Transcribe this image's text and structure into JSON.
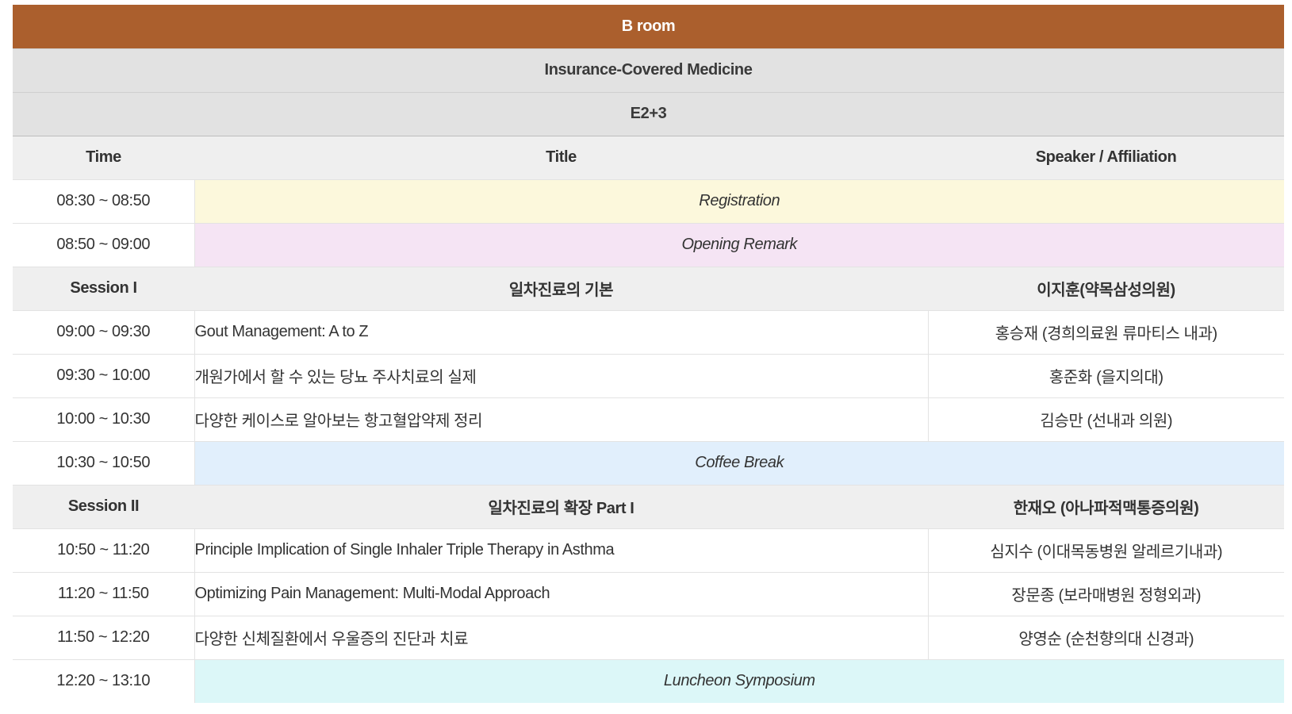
{
  "header": {
    "room": "B room",
    "track": "Insurance-Covered Medicine",
    "location": "E2+3"
  },
  "columns": {
    "time": "Time",
    "title": "Title",
    "speaker": "Speaker / Affiliation"
  },
  "rows": [
    {
      "time": "08:30 ~ 08:50",
      "label": "Registration"
    },
    {
      "time": "08:50 ~ 09:00",
      "label": "Opening Remark"
    },
    {
      "session": "Session I",
      "title": "일차진료의 기본",
      "chair": "이지훈(약목삼성의원)"
    },
    {
      "time": "09:00 ~ 09:30",
      "title": "Gout Management: A to Z",
      "speaker": "홍승재 (경희의료원 류마티스 내과)"
    },
    {
      "time": "09:30 ~ 10:00",
      "title": "개원가에서 할 수 있는 당뇨 주사치료의 실제",
      "speaker": "홍준화 (을지의대)"
    },
    {
      "time": "10:00 ~ 10:30",
      "title": "다양한 케이스로 알아보는 항고혈압약제 정리",
      "speaker": "김승만 (선내과 의원)"
    },
    {
      "time": "10:30 ~ 10:50",
      "label": "Coffee Break"
    },
    {
      "session": "Session II",
      "title": "일차진료의 확장 Part I",
      "chair": "한재오 (아나파적맥통증의원)"
    },
    {
      "time": "10:50 ~ 11:20",
      "title": "Principle Implication of Single Inhaler Triple Therapy in Asthma",
      "speaker": "심지수 (이대목동병원 알레르기내과)"
    },
    {
      "time": "11:20 ~ 11:50",
      "title": "Optimizing Pain Management: Multi-Modal Approach",
      "speaker": "장문종 (보라매병원 정형외과)"
    },
    {
      "time": "11:50 ~ 12:20",
      "title": "다양한 신체질환에서 우울증의 진단과 치료",
      "speaker": "양영순 (순천향의대 신경과)"
    },
    {
      "time": "12:20 ~ 13:10",
      "label": "Luncheon Symposium"
    }
  ],
  "colors": {
    "room_header": "#ab5f2d",
    "registration": "#fcf8dc",
    "opening": "#f5e4f4",
    "coffee": "#e1effc",
    "luncheon": "#dcf7f8"
  }
}
